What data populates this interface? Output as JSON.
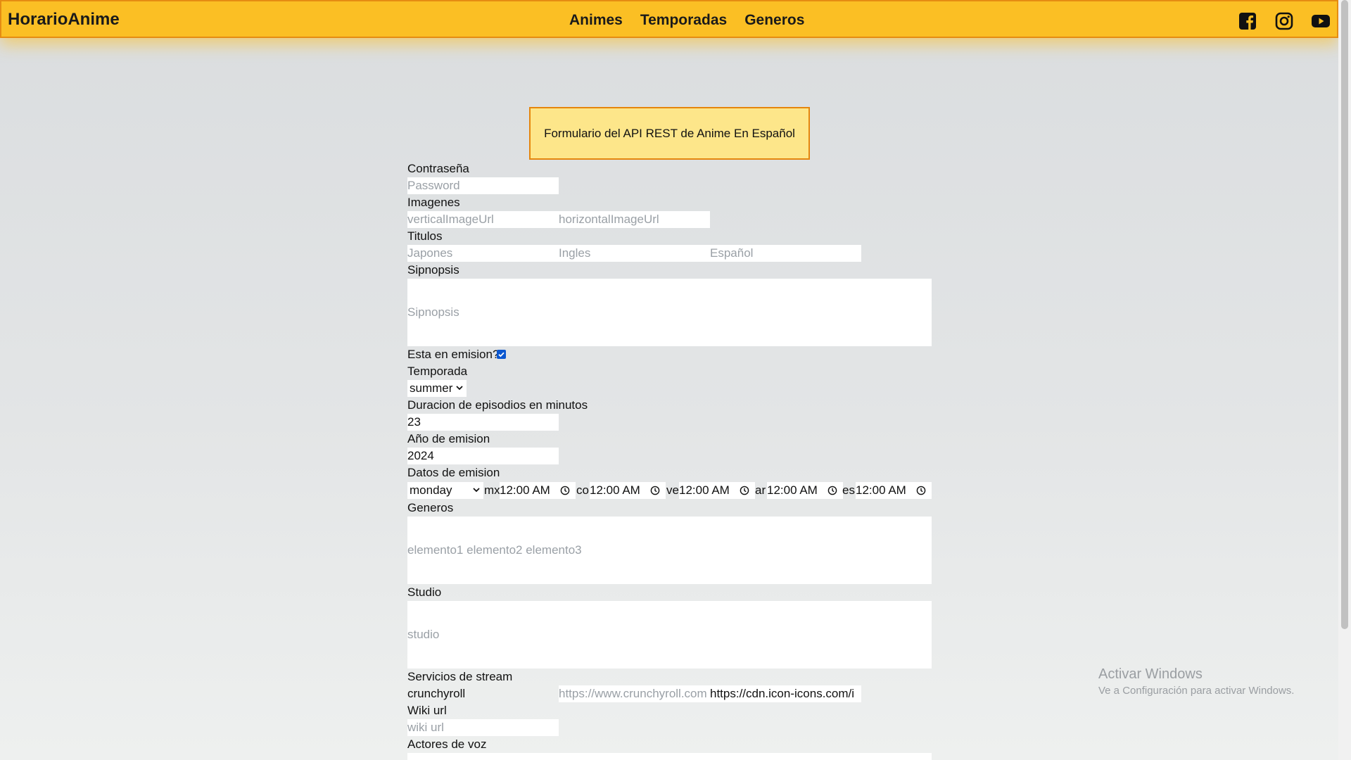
{
  "nav": {
    "brand": "HorarioAnime",
    "links": [
      "Animes",
      "Temporadas",
      "Generos"
    ],
    "icons": [
      "facebook-icon",
      "instagram-icon",
      "youtube-icon"
    ]
  },
  "form": {
    "title": "Formulario del API REST de Anime En Español",
    "password_label": "Contraseña",
    "password_placeholder": "Password",
    "images_label": "Imagenes",
    "vertical_placeholder": "verticalImageUrl",
    "horizontal_placeholder": "horizontalImageUrl",
    "titles_label": "Titulos",
    "japones_placeholder": "Japones",
    "ingles_placeholder": "Ingles",
    "espanol_placeholder": "Español",
    "sinopsis_label": "Sipnopsis",
    "sinopsis_placeholder": "Sipnopsis",
    "emision_label": "Esta en emision?",
    "emision_checked": true,
    "temporada_label": "Temporada",
    "temporada_value": "summer",
    "duracion_label": "Duracion de episodios en minutos",
    "duracion_value": "23",
    "anio_label": "Año de emision",
    "anio_value": "2024",
    "datos_label": "Datos de emision",
    "day_value": "monday",
    "times": [
      {
        "prefix": "mx",
        "value": "12:00 AM"
      },
      {
        "prefix": "co",
        "value": "12:00 AM"
      },
      {
        "prefix": "ve",
        "value": "12:00 AM"
      },
      {
        "prefix": "ar",
        "value": "12:00 AM"
      },
      {
        "prefix": "es",
        "value": "12:00 AM"
      }
    ],
    "generos_label": "Generos",
    "generos_placeholder": "elemento1 elemento2 elemento3",
    "studio_label": "Studio",
    "studio_placeholder": "studio",
    "stream_label": "Servicios de stream",
    "stream_name_value": "crunchyroll",
    "stream_url_placeholder": "https://www.crunchyroll.com",
    "stream_icon_value": "https://cdn.icon-icons.com/i",
    "wiki_label": "Wiki url",
    "wiki_placeholder": "wiki url",
    "actores_label": "Actores de voz"
  },
  "watermark": {
    "title": "Activar Windows",
    "subtitle": "Ve a Configuración para activar Windows."
  },
  "colors": {
    "navbar": "#fbbf24",
    "navbar_border": "#e58c12",
    "title_box": "#fde68a",
    "checkbox": "#0b57d0"
  }
}
